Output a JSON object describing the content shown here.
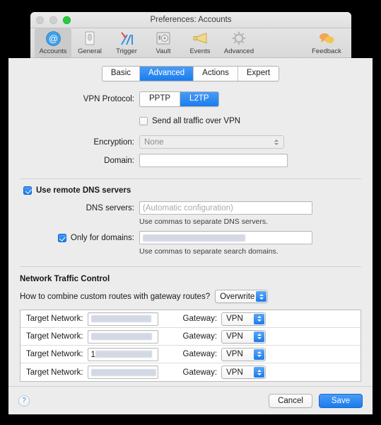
{
  "window": {
    "title": "Preferences: Accounts",
    "traffic_lights": [
      "close",
      "minimize",
      "zoom"
    ]
  },
  "toolbar": {
    "items": [
      {
        "label": "Accounts",
        "icon": "at-sign-icon",
        "selected": true
      },
      {
        "label": "General",
        "icon": "switch-icon",
        "selected": false
      },
      {
        "label": "Trigger",
        "icon": "trigger-arrow-icon",
        "selected": false
      },
      {
        "label": "Vault",
        "icon": "safe-icon",
        "selected": false
      },
      {
        "label": "Events",
        "icon": "megaphone-icon",
        "selected": false
      },
      {
        "label": "Advanced",
        "icon": "gear-icon",
        "selected": false
      }
    ],
    "feedback": {
      "label": "Feedback",
      "icon": "speech-bubbles-icon"
    }
  },
  "tabs": [
    {
      "label": "Basic",
      "active": false
    },
    {
      "label": "Advanced",
      "active": true
    },
    {
      "label": "Actions",
      "active": false
    },
    {
      "label": "Expert",
      "active": false
    }
  ],
  "form": {
    "vpn_protocol": {
      "label": "VPN Protocol:",
      "options": [
        "PPTP",
        "L2TP"
      ],
      "selected": "L2TP"
    },
    "send_all_traffic": {
      "label": "Send all traffic over VPN",
      "checked": false
    },
    "encryption": {
      "label": "Encryption:",
      "value": "None",
      "disabled": true
    },
    "domain": {
      "label": "Domain:",
      "value": "",
      "placeholder": ""
    }
  },
  "dns": {
    "use_remote": {
      "label": "Use remote DNS servers",
      "checked": true
    },
    "servers": {
      "label": "DNS servers:",
      "value": "",
      "placeholder": "(Automatic configuration)",
      "hint": "Use commas to separate DNS servers."
    },
    "only_for_domains": {
      "label": "Only for domains:",
      "checked": true,
      "value": "",
      "redacted": true,
      "hint": "Use commas to separate search domains."
    }
  },
  "network_traffic_control": {
    "title": "Network Traffic Control",
    "combine_question": "How to combine custom routes with gateway routes?",
    "combine_value": "Overwrite",
    "route_label": "Target Network:",
    "gateway_label": "Gateway:",
    "routes": [
      {
        "target": "",
        "target_redacted": true,
        "redact_width": 86,
        "prefix": "",
        "gateway": "VPN"
      },
      {
        "target": "",
        "target_redacted": true,
        "redact_width": 86,
        "prefix": "",
        "gateway": "VPN"
      },
      {
        "target": "",
        "target_redacted": true,
        "redact_width": 86,
        "prefix": "1",
        "gateway": "VPN"
      },
      {
        "target": "",
        "target_redacted": true,
        "redact_width": 95,
        "prefix": "",
        "gateway": "VPN"
      }
    ],
    "add_label": "+",
    "remove_label": "—"
  },
  "footer": {
    "help_label": "?",
    "cancel_label": "Cancel",
    "save_label": "Save"
  },
  "colors": {
    "accent": "#1a7ced",
    "window_bg": "#ececec",
    "redact": "#d2d9e4"
  }
}
